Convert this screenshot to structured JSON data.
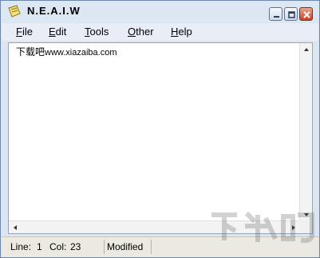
{
  "window": {
    "title": "N.E.A.I.W"
  },
  "menu": {
    "items": [
      {
        "mnemonic": "F",
        "rest": "ile"
      },
      {
        "mnemonic": "E",
        "rest": "dit"
      },
      {
        "mnemonic": "T",
        "rest": "ools"
      },
      {
        "mnemonic": "O",
        "rest": "ther"
      },
      {
        "mnemonic": "H",
        "rest": "elp"
      }
    ]
  },
  "editor": {
    "text_cjk": "下载吧",
    "text_url": "www.xiazaiba.com"
  },
  "status": {
    "line_label": "Line:",
    "line_value": "1",
    "col_label": "Col:",
    "col_value": "23",
    "modified": "Modified"
  },
  "icons": {
    "app": "notepad-icon",
    "minimize": "minimize-icon",
    "maximize": "maximize-icon",
    "close": "close-icon"
  },
  "colors": {
    "titlebar": "#dde7f3",
    "close_button": "#c0472b",
    "statusbar": "#ece9e1"
  }
}
